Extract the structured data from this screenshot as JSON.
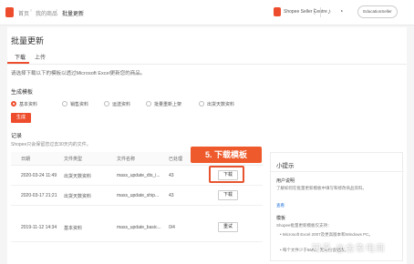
{
  "nav": {
    "home": "首页",
    "my_products": "我的商品",
    "current": "批量更新",
    "brand": "Shopee Seller Centre",
    "account": "EducationSeller"
  },
  "page": {
    "title": "批量更新",
    "tabs": [
      {
        "label": "下载",
        "active": true
      },
      {
        "label": "上传",
        "active": false
      }
    ],
    "description": "请选择下载以下的模板以透过Microsoft Excel更新您的商品。"
  },
  "template": {
    "section_title": "生成模板",
    "options": [
      {
        "label": "基本资料",
        "checked": true
      },
      {
        "label": "销售资料",
        "checked": false
      },
      {
        "label": "运送资料",
        "checked": false
      },
      {
        "label": "批量重新上架",
        "checked": false
      },
      {
        "label": "出货天数资料",
        "checked": false
      }
    ],
    "generate_label": "生成"
  },
  "records": {
    "section_title": "记录",
    "description": "Shopee只会保留您过去30天内的文件。",
    "headers": [
      "日期",
      "文件类型",
      "文件名称",
      "已处理",
      ""
    ],
    "rows": [
      {
        "date": "2020-03-24 11:49",
        "type": "出货天数资料",
        "name": "mass_update_dts_i...",
        "processed": "43",
        "action": "下载"
      },
      {
        "date": "2020-03-17 21:21",
        "type": "出货天数资料",
        "name": "mass_update_ship...",
        "processed": "43",
        "action": "下载"
      },
      {
        "date": "2019-11-12 14:34",
        "type": "基本资料",
        "name": "mass_update_basic...",
        "processed": "0/4",
        "action": "重试"
      }
    ]
  },
  "callout": "5. 下载模板",
  "tips": {
    "title": "小提示",
    "user_guide_heading": "用户说明",
    "user_guide_text": "了解如何在批量更新模板中填写和修改商品资料。",
    "user_guide_link": "查看",
    "template_heading": "模板",
    "template_text": "Shopee批量更新模板仅支持：",
    "bullets": [
      "Microsoft Excel 2007及更高版本和Windows PC。",
      "每个文件少于5MB，无法包含更改。"
    ]
  },
  "watermark": "知乎 @金象电商",
  "colors": {
    "accent": "#ee4d2d",
    "callout": "#ee5a2b",
    "link": "#2673dd"
  }
}
